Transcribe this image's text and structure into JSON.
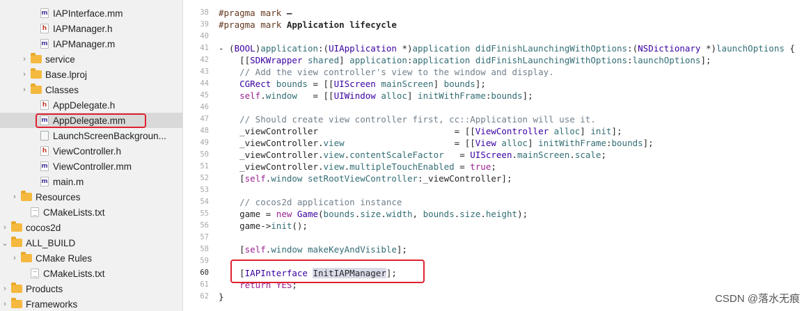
{
  "navigator": {
    "items": [
      {
        "label": "IAPInterface.mm",
        "icon": "m-file-icon"
      },
      {
        "label": "IAPManager.h",
        "icon": "h-file-icon"
      },
      {
        "label": "IAPManager.m",
        "icon": "m-file-icon"
      },
      {
        "label": "service",
        "icon": "folder-icon"
      },
      {
        "label": "Base.lproj",
        "icon": "folder-icon"
      },
      {
        "label": "Classes",
        "icon": "folder-icon"
      },
      {
        "label": "AppDelegate.h",
        "icon": "h-file-icon"
      },
      {
        "label": "AppDelegate.mm",
        "icon": "m-file-icon"
      },
      {
        "label": "LaunchScreenBackgroun...",
        "icon": "storyboard-icon"
      },
      {
        "label": "ViewController.h",
        "icon": "h-file-icon"
      },
      {
        "label": "ViewController.mm",
        "icon": "m-file-icon"
      },
      {
        "label": "main.m",
        "icon": "m-file-icon"
      },
      {
        "label": "Resources",
        "icon": "folder-icon"
      },
      {
        "label": "CMakeLists.txt",
        "icon": "text-file-icon"
      },
      {
        "label": "cocos2d",
        "icon": "folder-icon"
      },
      {
        "label": "ALL_BUILD",
        "icon": "folder-icon"
      },
      {
        "label": "CMake Rules",
        "icon": "folder-icon"
      },
      {
        "label": "CMakeLists.txt",
        "icon": "text-file-icon"
      },
      {
        "label": "Products",
        "icon": "folder-icon"
      },
      {
        "label": "Frameworks",
        "icon": "folder-icon"
      }
    ],
    "chevron_collapsed": "›",
    "chevron_expanded": "⌄",
    "file_badge_m": "m",
    "file_badge_h": "h"
  },
  "editor": {
    "lines": [
      {
        "num": "38",
        "text": "#pragma mark –"
      },
      {
        "num": "39",
        "text": "#pragma mark Application lifecycle"
      },
      {
        "num": "40",
        "text": ""
      },
      {
        "num": "41",
        "text": "- (BOOL)application:(UIApplication *)application didFinishLaunchingWithOptions:(NSDictionary *)launchOptions {"
      },
      {
        "num": "42",
        "text": "    [[SDKWrapper shared] application:application didFinishLaunchingWithOptions:launchOptions];"
      },
      {
        "num": "43",
        "text": "    // Add the view controller's view to the window and display."
      },
      {
        "num": "44",
        "text": "    CGRect bounds = [[UIScreen mainScreen] bounds];"
      },
      {
        "num": "45",
        "text": "    self.window   = [[UIWindow alloc] initWithFrame:bounds];"
      },
      {
        "num": "46",
        "text": ""
      },
      {
        "num": "47",
        "text": "    // Should create view controller first, cc::Application will use it."
      },
      {
        "num": "48",
        "text": "    _viewController                          = [[ViewController alloc] init];"
      },
      {
        "num": "49",
        "text": "    _viewController.view                     = [[View alloc] initWithFrame:bounds];"
      },
      {
        "num": "50",
        "text": "    _viewController.view.contentScaleFactor   = UIScreen.mainScreen.scale;"
      },
      {
        "num": "51",
        "text": "    _viewController.view.multipleTouchEnabled = true;"
      },
      {
        "num": "52",
        "text": "    [self.window setRootViewController:_viewController];"
      },
      {
        "num": "53",
        "text": ""
      },
      {
        "num": "54",
        "text": "    // cocos2d application instance"
      },
      {
        "num": "55",
        "text": "    game = new Game(bounds.size.width, bounds.size.height);"
      },
      {
        "num": "56",
        "text": "    game->init();"
      },
      {
        "num": "57",
        "text": ""
      },
      {
        "num": "58",
        "text": "    [self.window makeKeyAndVisible];"
      },
      {
        "num": "59",
        "text": ""
      },
      {
        "num": "60",
        "text": "    [IAPInterface InitIAPManager];"
      },
      {
        "num": "61",
        "text": "    return YES;"
      },
      {
        "num": "62",
        "text": "}"
      }
    ],
    "current_line": "60"
  },
  "watermark": "CSDN @落水无痕"
}
